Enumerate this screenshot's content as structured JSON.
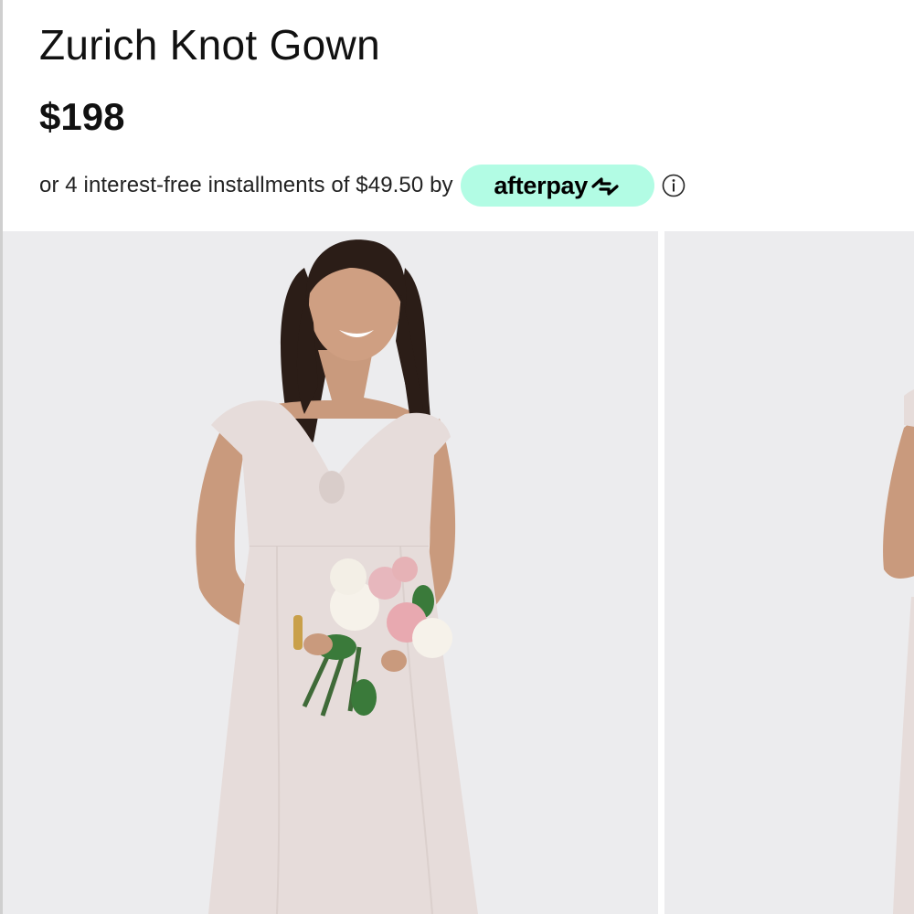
{
  "product": {
    "title": "Zurich Knot Gown",
    "price": "$198"
  },
  "payment": {
    "installments_text": "or 4 interest-free installments of $49.50 by",
    "provider_wordmark": "afterpay",
    "provider_icon": "afterpay-arrows-icon",
    "provider_badge_color": "#b2fce4",
    "info_icon": "info-circle-icon"
  },
  "gallery": {
    "images": [
      {
        "name": "product-photo-front",
        "description_visible": false
      },
      {
        "name": "product-photo-side",
        "description_visible": false
      }
    ],
    "background_color": "#ececee",
    "dress_color": "#e6dcda"
  }
}
